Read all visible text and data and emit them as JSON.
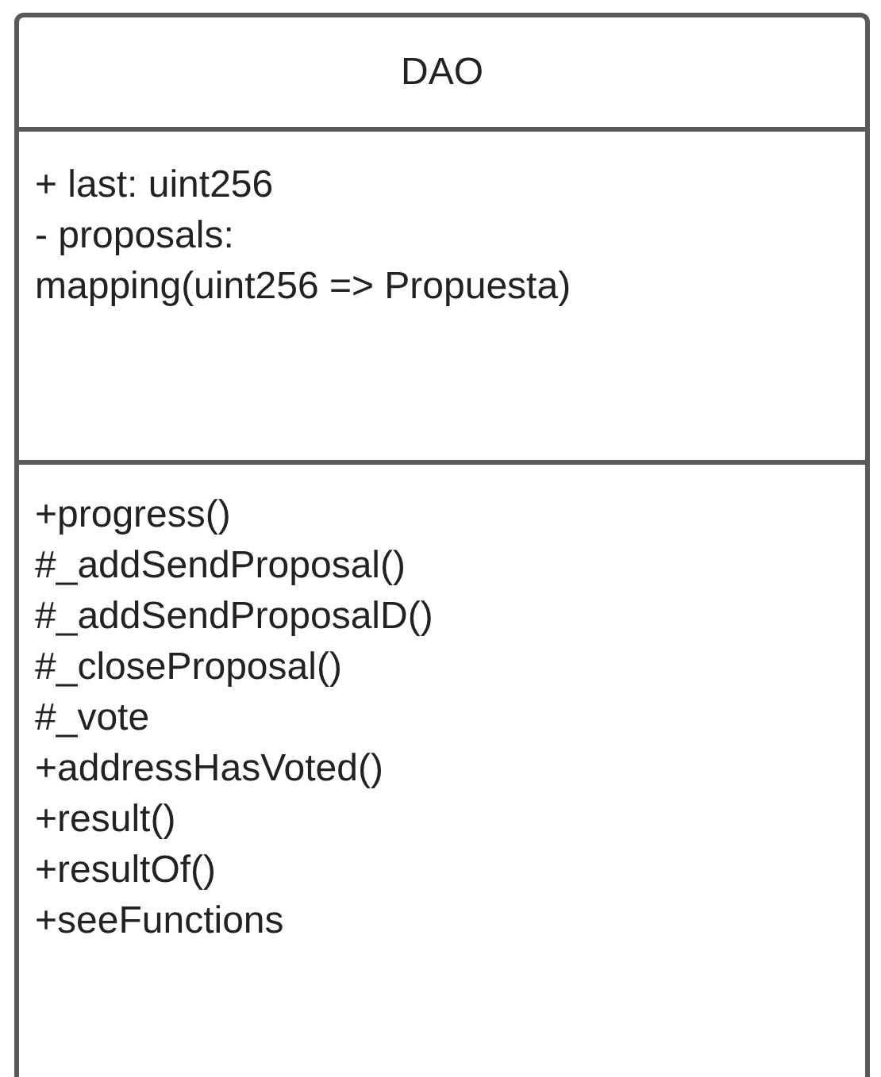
{
  "class": {
    "name": "DAO",
    "attributes": [
      "+ last: uint256",
      "- proposals:",
      "mapping(uint256 => Propuesta)"
    ],
    "methods": [
      "+progress()",
      "#_addSendProposal()",
      "#_addSendProposalD()",
      "#_closeProposal()",
      "#_vote",
      "+addressHasVoted()",
      "+result()",
      "+resultOf()",
      "+seeFunctions"
    ]
  }
}
